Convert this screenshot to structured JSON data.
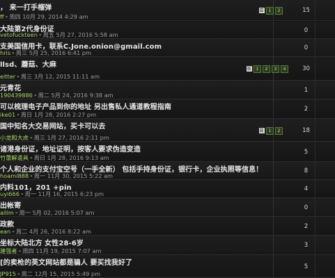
{
  "forum": {
    "topics": [
      {
        "title": "， 来一打手榴弹",
        "author": "ff",
        "date": "周四 10月 29, 2014 4:29 am",
        "replies": "15",
        "pages": [
          "1",
          "2"
        ]
      },
      {
        "title": "大陆第2代身份证",
        "author": "vetofuckteen",
        "date": "周五 5月 27, 2016 5:58 am",
        "replies": "0",
        "pages": []
      },
      {
        "title": "支美国信用卡，联系C.Jone.onion@gmail.com",
        "author": "hris",
        "date": "周三 5月 25, 2016 6:41 pm",
        "replies": "0",
        "pages": []
      },
      {
        "title": "llsd、蘑菇、大麻",
        "author": "eitter",
        "date": "周三 3月 12, 2015 11:11 am",
        "replies": "30",
        "pages": [
          "1",
          "2",
          "3",
          "4"
        ]
      },
      {
        "title": "元青花",
        "author": "190439886",
        "date": "周二 5月 24, 2016 9:38 am",
        "replies": "1",
        "pages": []
      },
      {
        "title": "可以梳理电子产品到你的地址 另出售私人通道教程指南",
        "author": "ike01",
        "date": "周日 1月 28, 2016 2:27 pm",
        "replies": "2",
        "pages": []
      },
      {
        "title": "国中知名大交易网站，买卡可以去",
        "author": "小龙和大虎",
        "date": "周三 1月 27, 2016 2:11 pm",
        "replies": "18",
        "pages": [
          "1",
          "2"
        ]
      },
      {
        "title": "诸港身份证，地址证明，按客人要求伪造变造",
        "author": "竹蕾解遣具",
        "date": "周日 1月 28, 2016 9:13 am",
        "replies": "5",
        "pages": []
      },
      {
        "title": "个人和企业的支付宝空号（一手全新） 包括手持身份证，银行卡，企业执照等信息！",
        "author": "hoami888",
        "date": "周一 11月 30, 2015 5:22 am",
        "replies": "8",
        "pages": []
      },
      {
        "title": "内料101，201 +pin",
        "author": "uyi666",
        "date": "周一 11月 16, 2015 6:23 pm",
        "replies": "4",
        "pages": []
      },
      {
        "title": "出帐寄",
        "author": "allim",
        "date": "周一 5月 02, 2016 5:07 am",
        "replies": "0",
        "pages": []
      },
      {
        "title": "政款",
        "author": "ean",
        "date": "周二 4月 26, 2016 8:22 am",
        "replies": "2",
        "pages": []
      },
      {
        "title": "坐标大陆北方 女性28-6岁",
        "author": "建强者",
        "date": "周四 11月 19, 2015 7:07 am",
        "replies": "3",
        "pages": []
      },
      {
        "title": "[的卖枪的英文网站都是骗人 要买找我好了",
        "author": "JP915",
        "date": "周二 12月 15, 2015 5:49 pm",
        "replies": "5",
        "pages": []
      }
    ]
  }
}
